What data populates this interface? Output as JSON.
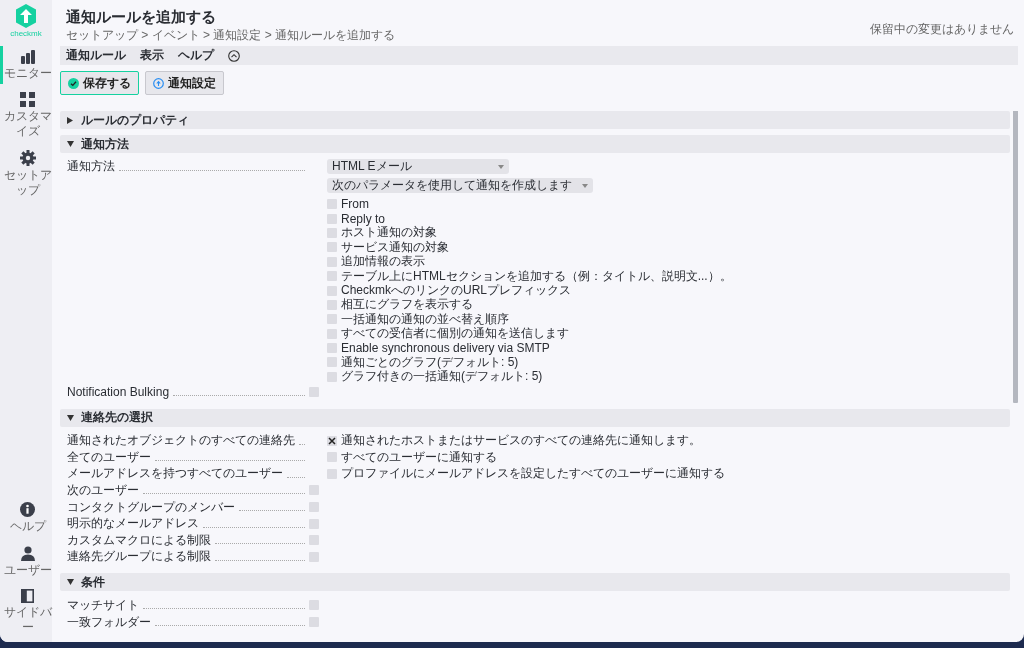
{
  "logo": {
    "text": "checkmk"
  },
  "nav_top": [
    {
      "label": "モニター",
      "selected": true
    },
    {
      "label": "カスタマイズ",
      "selected": false
    },
    {
      "label": "セットアップ",
      "selected": false
    }
  ],
  "nav_bottom": [
    {
      "label": "ヘルプ",
      "selected": false
    },
    {
      "label": "ユーザー",
      "selected": false
    },
    {
      "label": "サイドバー",
      "selected": false
    }
  ],
  "title": "通知ルールを追加する",
  "breadcrumb": "セットアップ > イベント > 通知設定 > 通知ルールを追加する",
  "pending_changes": "保留中の変更はありません",
  "menu": [
    "通知ルール",
    "表示",
    "ヘルプ"
  ],
  "buttons": [
    {
      "label": "保存する",
      "kind": "save"
    },
    {
      "label": "通知設定",
      "kind": "info"
    }
  ],
  "sections": [
    {
      "title": "ルールのプロパティ",
      "expanded": false
    },
    {
      "title": "通知方法",
      "expanded": true,
      "rows": [
        {
          "kind": "method",
          "label": "通知方法",
          "dropdowns": [
            "HTML Eメール",
            "次のパラメータを使用して通知を作成します"
          ],
          "options": [
            {
              "label": "From",
              "checked": false
            },
            {
              "label": "Reply to",
              "checked": false
            },
            {
              "label": "ホスト通知の対象",
              "checked": false
            },
            {
              "label": "サービス通知の対象",
              "checked": false
            },
            {
              "label": "追加情報の表示",
              "checked": false
            },
            {
              "label": "テーブル上にHTMLセクションを追加する（例：タイトル、説明文...）。",
              "checked": false
            },
            {
              "label": "CheckmkへのリンクのURLプレフィックス",
              "checked": false
            },
            {
              "label": "相互にグラフを表示する",
              "checked": false
            },
            {
              "label": "一括通知の通知の並べ替え順序",
              "checked": false
            },
            {
              "label": "すべての受信者に個別の通知を送信します",
              "checked": false
            },
            {
              "label": "Enable synchronous delivery via SMTP",
              "checked": false
            },
            {
              "label": "通知ごとのグラフ(デフォルト: 5)",
              "checked": false
            },
            {
              "label": "グラフ付きの一括通知(デフォルト: 5)",
              "checked": false
            }
          ]
        },
        {
          "kind": "toggle",
          "label": "Notification Bulking",
          "checked": false
        }
      ]
    },
    {
      "title": "連絡先の選択",
      "expanded": true,
      "rows": [
        {
          "kind": "option",
          "label": "通知されたオブジェクトのすべての連絡先",
          "option": {
            "label": "通知されたホストまたはサービスのすべての連絡先に通知します。",
            "checked": true
          }
        },
        {
          "kind": "option",
          "label": "全てのユーザー",
          "option": {
            "label": "すべてのユーザーに通知する",
            "checked": false
          }
        },
        {
          "kind": "option",
          "label": "メールアドレスを持つすべてのユーザー",
          "option": {
            "label": "プロファイルにメールアドレスを設定したすべてのユーザーに通知する",
            "checked": false
          }
        },
        {
          "kind": "toggle",
          "label": "次のユーザー",
          "checked": false
        },
        {
          "kind": "toggle",
          "label": "コンタクトグループのメンバー",
          "checked": false
        },
        {
          "kind": "toggle",
          "label": "明示的なメールアドレス",
          "checked": false
        },
        {
          "kind": "toggle",
          "label": "カスタムマクロによる制限",
          "checked": false
        },
        {
          "kind": "toggle",
          "label": "連絡先グループによる制限",
          "checked": false
        }
      ]
    },
    {
      "title": "条件",
      "expanded": true,
      "rows": [
        {
          "kind": "toggle",
          "label": "マッチサイト",
          "checked": false
        },
        {
          "kind": "toggle",
          "label": "一致フォルダー",
          "checked": false
        }
      ]
    }
  ]
}
